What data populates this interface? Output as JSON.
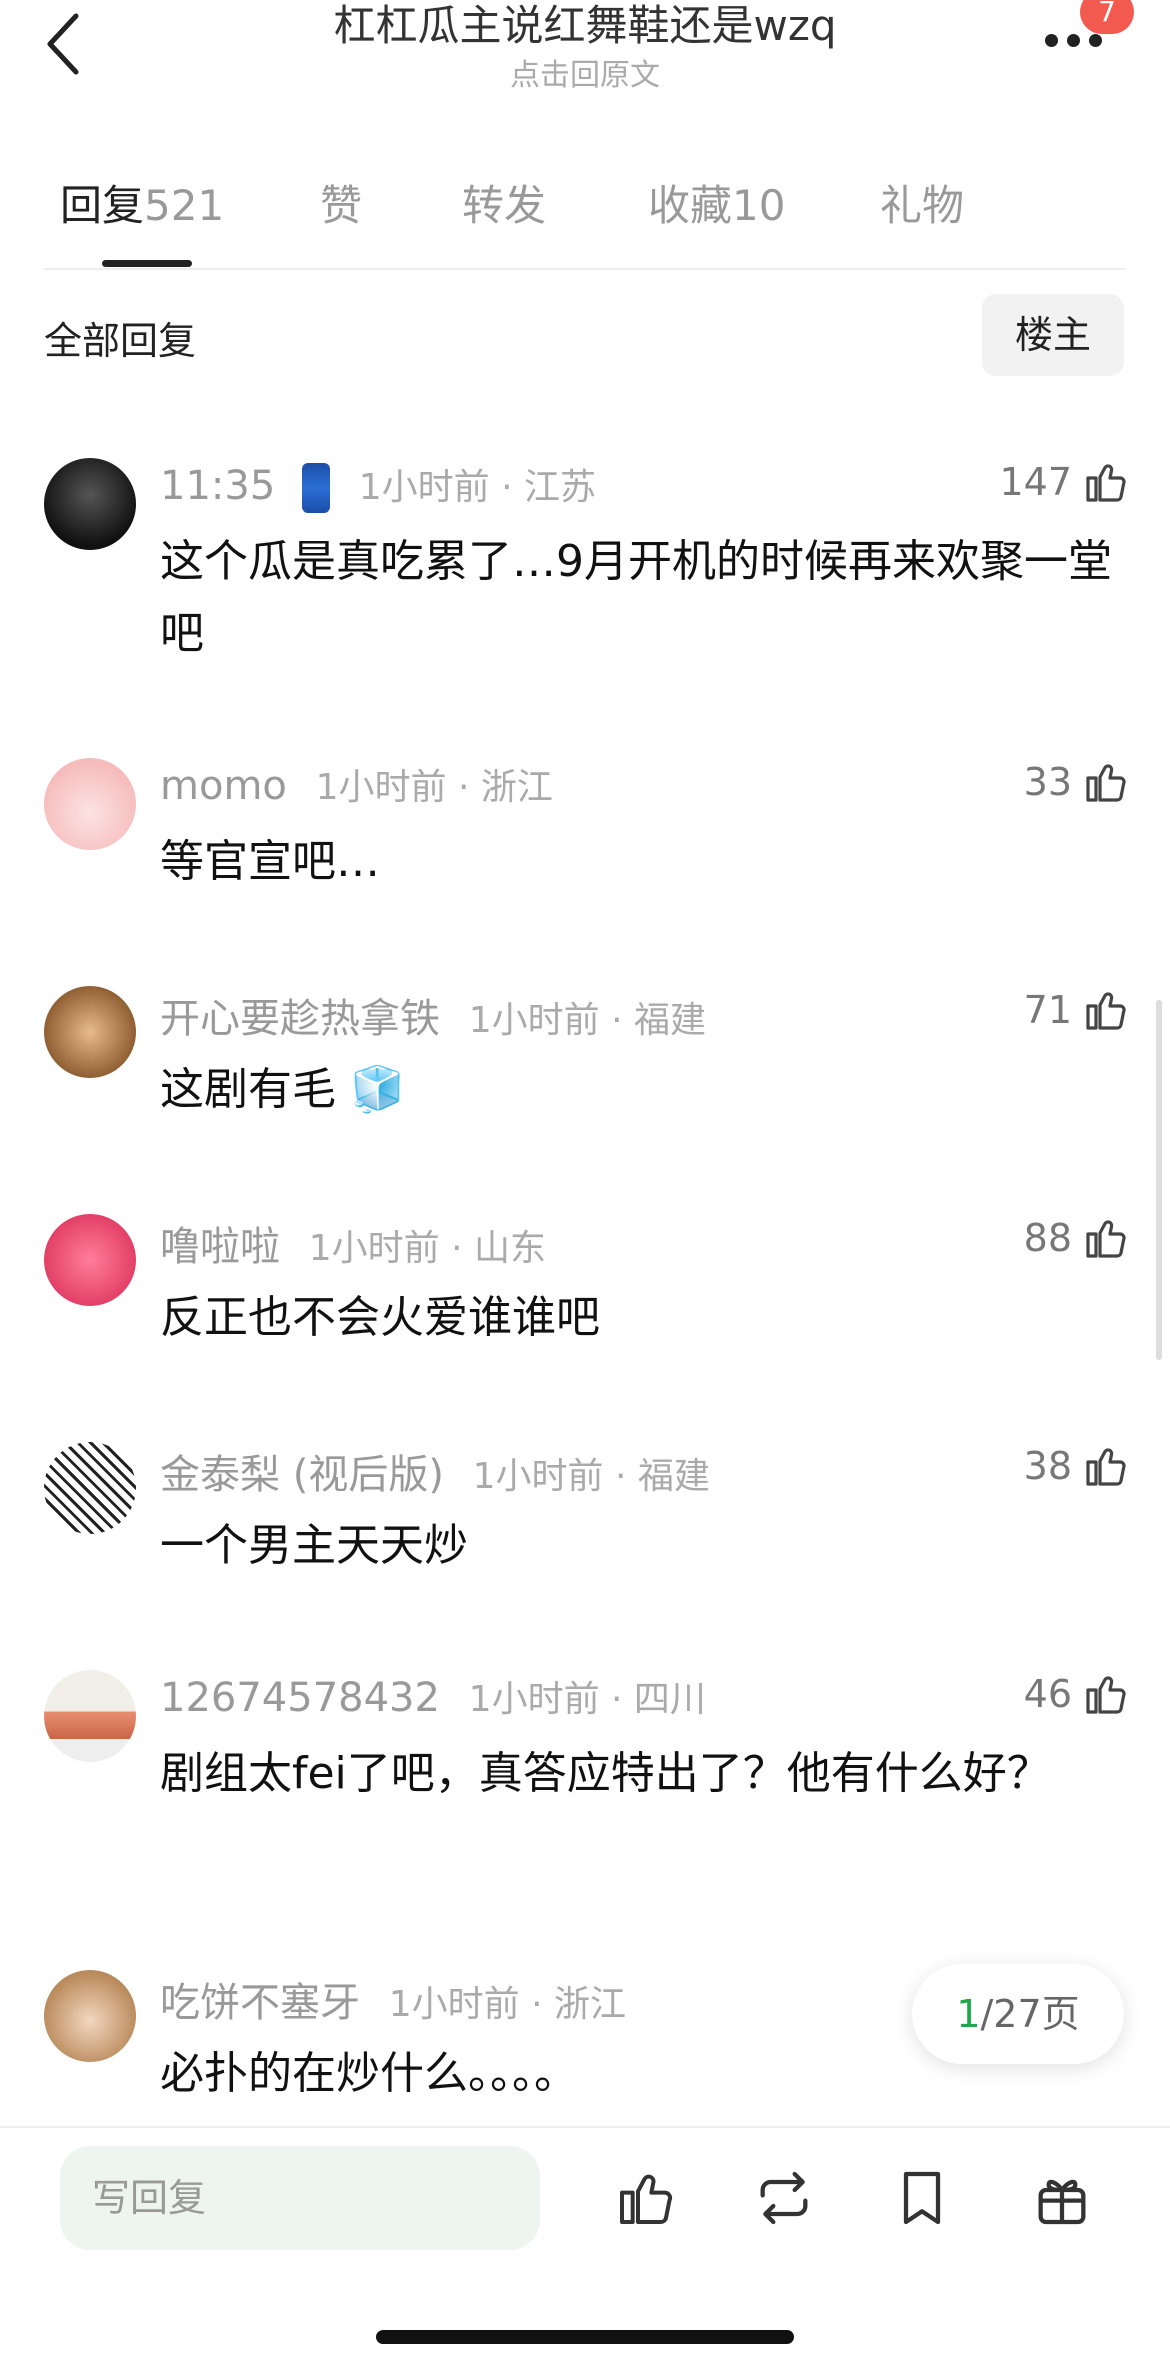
{
  "header": {
    "title": "杠杠瓜主说红舞鞋还是wzq",
    "subtitle": "点击回原文",
    "notification_count": "7"
  },
  "tabs": [
    {
      "label": "回复",
      "count": "521"
    },
    {
      "label": "赞",
      "count": ""
    },
    {
      "label": "转发",
      "count": ""
    },
    {
      "label": "收藏",
      "count": "10"
    },
    {
      "label": "礼物",
      "count": ""
    }
  ],
  "filter": {
    "all_replies": "全部回复",
    "owner_button": "楼主"
  },
  "comments": [
    {
      "user": "11:35",
      "time": "1小时前 · 江苏",
      "likes": "147",
      "text": "这个瓜是真吃累了…9月开机的时候再来欢聚一堂吧"
    },
    {
      "user": "momo",
      "time": "1小时前 · 浙江",
      "likes": "33",
      "text": "等官宣吧…"
    },
    {
      "user": "开心要趁热拿铁",
      "time": "1小时前 · 福建",
      "likes": "71",
      "text": "这剧有毛 🧊"
    },
    {
      "user": "噜啦啦",
      "time": "1小时前 · 山东",
      "likes": "88",
      "text": "反正也不会火爱谁谁吧"
    },
    {
      "user": "金泰梨 (视后版)",
      "time": "1小时前 · 福建",
      "likes": "38",
      "text": "一个男主天天炒"
    },
    {
      "user": "12674578432",
      "time": "1小时前 · 四川",
      "likes": "46",
      "text": "剧组太fei了吧，真答应特出了？他有什么好？"
    },
    {
      "user": "吃饼不塞牙",
      "time": "1小时前 · 浙江",
      "likes": "",
      "text": "必扑的在炒什么。。。。"
    }
  ],
  "pager": {
    "current": "1",
    "total": "/27页"
  },
  "bottom_bar": {
    "reply_placeholder": "写回复"
  },
  "colors": {
    "accent_green": "#1ea84a",
    "badge_red": "#f25a4f"
  },
  "icons": [
    "back-icon",
    "more-icon",
    "like-icon",
    "repost-icon",
    "bookmark-icon",
    "gift-icon"
  ]
}
